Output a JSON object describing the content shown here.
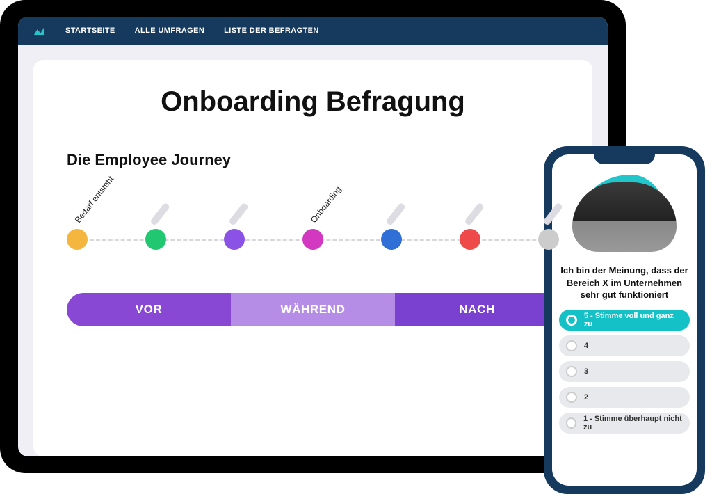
{
  "nav": {
    "items": [
      "STARTSEITE",
      "ALLE UMFRAGEN",
      "LISTE DER BEFRAGTEN"
    ]
  },
  "page": {
    "title": "Onboarding Befragung",
    "section": "Die Employee Journey"
  },
  "journey": {
    "nodes": [
      {
        "color": "#f4b63f",
        "label": "Bedarf entsteht"
      },
      {
        "color": "#22c771",
        "label": ""
      },
      {
        "color": "#8b52e6",
        "label": ""
      },
      {
        "color": "#d338c1",
        "label": "Onboarding"
      },
      {
        "color": "#2f6fd6",
        "label": ""
      },
      {
        "color": "#ef4a4a",
        "label": ""
      },
      {
        "color": "#cccccc",
        "label": ""
      }
    ],
    "phases": {
      "vor": "VOR",
      "waehrend": "WÄHREND",
      "nach": "NACH"
    }
  },
  "phone": {
    "question": "Ich bin der Meinung, dass der Bereich X im Unternehmen sehr gut funktioniert",
    "options": [
      {
        "label": "5 - Stimme voll und ganz zu",
        "selected": true
      },
      {
        "label": "4",
        "selected": false
      },
      {
        "label": "3",
        "selected": false
      },
      {
        "label": "2",
        "selected": false
      },
      {
        "label": "1 - Stimme überhaupt nicht zu",
        "selected": false
      }
    ]
  },
  "colors": {
    "navbar": "#163a5d",
    "accent": "#14c1c6"
  }
}
